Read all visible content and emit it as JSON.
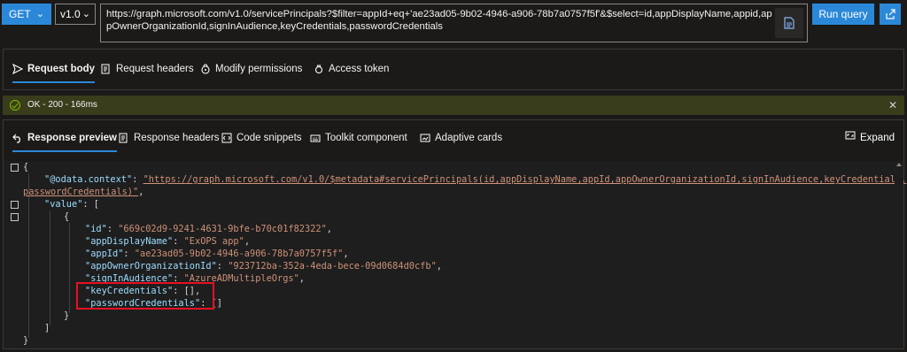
{
  "query": {
    "method": "GET",
    "version": "v1.0",
    "url": "https://graph.microsoft.com/v1.0/servicePrincipals?$filter=appId+eq+'ae23ad05-9b02-4946-a906-78b7a0757f5f'&$select=id,appDisplayName,appid,appOwnerOrganizationId,signInAudience,keyCredentials,passwordCredentials",
    "run_label": "Run query"
  },
  "request_tabs": [
    {
      "label": "Request body",
      "icon": "send-icon",
      "active": true
    },
    {
      "label": "Request headers",
      "icon": "headers-icon",
      "active": false
    },
    {
      "label": "Modify permissions",
      "icon": "lock-icon",
      "active": false
    },
    {
      "label": "Access token",
      "icon": "key-icon",
      "active": false
    }
  ],
  "status": {
    "text": "OK - 200 - 166ms",
    "color": "#393d1b"
  },
  "response_tabs": [
    {
      "label": "Response preview",
      "icon": "return-icon",
      "active": true
    },
    {
      "label": "Response headers",
      "icon": "headers-icon",
      "active": false
    },
    {
      "label": "Code snippets",
      "icon": "code-icon",
      "active": false
    },
    {
      "label": "Toolkit component",
      "icon": "toolkit-icon",
      "active": false
    },
    {
      "label": "Adaptive cards",
      "icon": "card-icon",
      "active": false
    }
  ],
  "expand_label": "Expand",
  "json": {
    "odata_key": "\"@odata.context\"",
    "odata_value_1": "\"https://graph.microsoft.com/v1.0/$metadata#servicePrincipals(id,appDisplayName,appId,appOwnerOrganizationId,signInAudience,keyCredentials,",
    "odata_value_2": "passwordCredentials)\"",
    "value_key": "\"value\"",
    "fields": [
      {
        "key": "\"id\"",
        "value": "\"669c02d9-9241-4631-9bfe-b70c01f82322\""
      },
      {
        "key": "\"appDisplayName\"",
        "value": "\"ExOPS app\""
      },
      {
        "key": "\"appId\"",
        "value": "\"ae23ad05-9b02-4946-a906-78b7a0757f5f\""
      },
      {
        "key": "\"appOwnerOrganizationId\"",
        "value": "\"923712ba-352a-4eda-bece-09d0684d0cfb\""
      },
      {
        "key": "\"signInAudience\"",
        "value": "\"AzureADMultipleOrgs\""
      },
      {
        "key": "\"keyCredentials\"",
        "value": "[]"
      },
      {
        "key": "\"passwordCredentials\"",
        "value": "[]"
      }
    ]
  },
  "colors": {
    "accent": "#2b88d8",
    "highlight": "#e81123",
    "json_key": "#9cdcfe",
    "json_string": "#ce9178"
  }
}
